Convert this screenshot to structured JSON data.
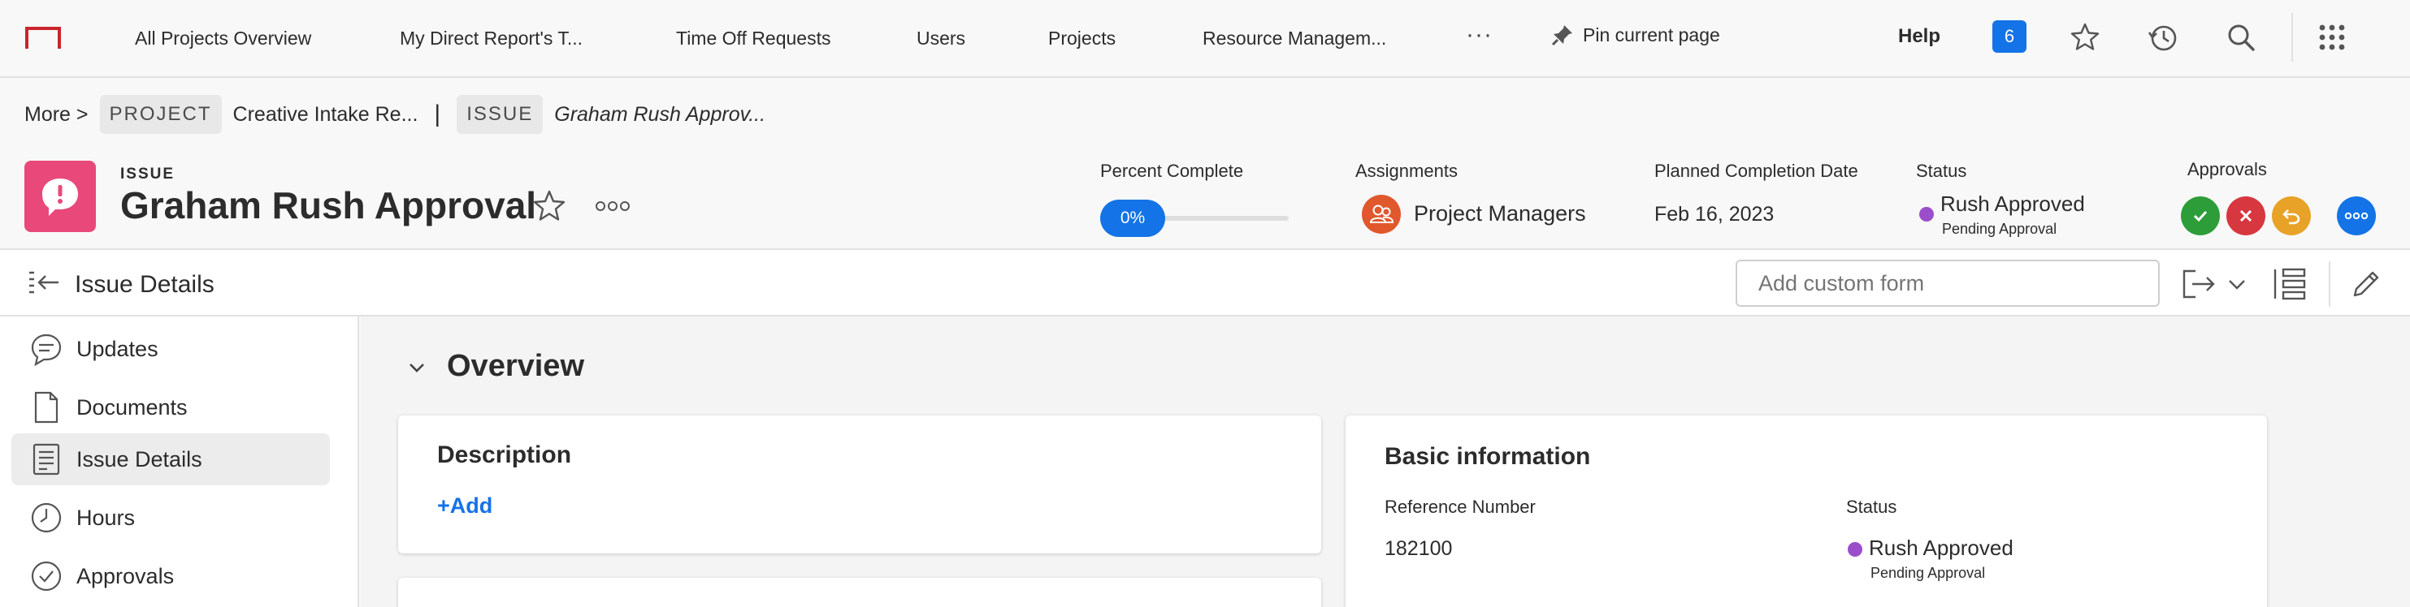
{
  "brand": {
    "accent": "#c9252c",
    "primary_blue": "#1473e6",
    "issue_pink": "#e9497a",
    "status_purple": "#9b4dca"
  },
  "topnav": {
    "items": [
      "All Projects Overview",
      "My Direct Report's T...",
      "Time Off Requests",
      "Users",
      "Projects",
      "Resource Managem..."
    ],
    "more_label": "···",
    "pin_label": "Pin current page",
    "help_label": "Help",
    "notification_count": "6",
    "icons": [
      "star-icon",
      "history-icon",
      "search-icon",
      "app-grid-icon"
    ]
  },
  "breadcrumb": {
    "more": "More  >",
    "project_chip": "PROJECT",
    "project_name": "Creative Intake Re...",
    "separator": "|",
    "issue_chip": "ISSUE",
    "issue_name": "Graham Rush Approv..."
  },
  "header": {
    "kind": "ISSUE",
    "title": "Graham Rush Approval",
    "percent_complete_label": "Percent Complete",
    "percent_complete_value": "0%",
    "assignments_label": "Assignments",
    "assignee": "Project Managers",
    "planned_completion_label": "Planned Completion Date",
    "planned_completion_value": "Feb 16, 2023",
    "status_label": "Status",
    "status_value": "Rush Approved",
    "status_sub": "Pending Approval",
    "approvals_label": "Approvals",
    "approval_buttons": [
      {
        "name": "approve",
        "color": "#2d9d3a",
        "icon": "check-icon"
      },
      {
        "name": "reject",
        "color": "#d7373f",
        "icon": "close-icon"
      },
      {
        "name": "recall",
        "color": "#e8a227",
        "icon": "undo-icon"
      },
      {
        "name": "more",
        "color": "#1473e6",
        "icon": "more-icon"
      }
    ]
  },
  "toolbar": {
    "title": "Issue Details",
    "custom_form_placeholder": "Add custom form"
  },
  "sidebar": {
    "items": [
      {
        "label": "Updates",
        "icon": "speech-bubble-icon",
        "active": false
      },
      {
        "label": "Documents",
        "icon": "document-icon",
        "active": false
      },
      {
        "label": "Issue Details",
        "icon": "details-icon",
        "active": true
      },
      {
        "label": "Hours",
        "icon": "clock-icon",
        "active": false
      },
      {
        "label": "Approvals",
        "icon": "check-circle-icon",
        "active": false
      }
    ]
  },
  "main": {
    "section_title": "Overview",
    "description": {
      "title": "Description",
      "add_label": "+Add"
    },
    "basic_info": {
      "title": "Basic information",
      "reference_label": "Reference Number",
      "reference_value": "182100",
      "status_label": "Status",
      "status_value": "Rush Approved",
      "status_sub": "Pending Approval"
    }
  }
}
